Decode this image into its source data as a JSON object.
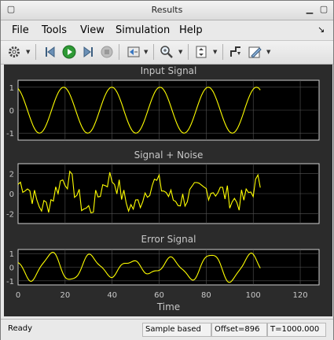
{
  "window": {
    "title": "Results"
  },
  "menu": [
    {
      "label": "File"
    },
    {
      "label": "Tools"
    },
    {
      "label": "View"
    },
    {
      "label": "Simulation"
    },
    {
      "label": "Help"
    }
  ],
  "toolbar_icons": [
    "settings-icon",
    "step-back-icon",
    "run-icon",
    "step-forward-icon",
    "stop-icon",
    "highlight-icon",
    "zoom-icon",
    "fit-to-view-icon",
    "triggers-icon",
    "style-icon"
  ],
  "plots": [
    {
      "title": "Input Signal",
      "y_ticks": [
        "1",
        "0",
        "-1"
      ],
      "ylim": [
        -1.3,
        1.3
      ],
      "kind": "sine",
      "amplitude": 1,
      "period": 20.5,
      "phase_start": 0.35
    },
    {
      "title": "Signal + Noise",
      "y_ticks": [
        "2",
        "0",
        "-2"
      ],
      "ylim": [
        -3,
        3
      ],
      "kind": "noisy"
    },
    {
      "title": "Error Signal",
      "y_ticks": [
        "1",
        "0",
        "-1"
      ],
      "ylim": [
        -1.3,
        1.3
      ],
      "kind": "error"
    }
  ],
  "x_axis": {
    "ticks": [
      "0",
      "20",
      "40",
      "60",
      "80",
      "100",
      "120"
    ],
    "xlim": [
      0,
      128
    ],
    "label": "Time",
    "data_end": 103
  },
  "colors": {
    "trace": "#ffff00",
    "grid": "#555555",
    "axes_bg": "#000000",
    "text": "#c8c8c8",
    "border": "#d0d0d0"
  },
  "status": {
    "state": "Ready",
    "mode": "Sample based",
    "offset": "Offset=896",
    "time": "T=1000.000"
  }
}
